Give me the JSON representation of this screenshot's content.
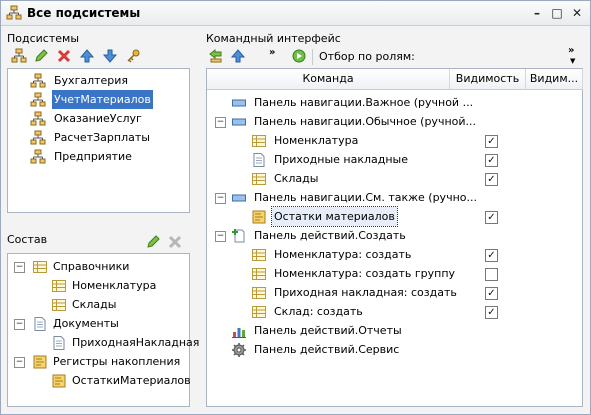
{
  "window": {
    "title": "Все подсистемы",
    "minimize_icon": "minimize-icon",
    "maximize_icon": "maximize-icon",
    "close_icon": "close-icon"
  },
  "subsystems": {
    "label": "Подсистемы",
    "toolbar": [
      "subsystem-tree-icon",
      "edit-pencil-icon",
      "delete-x-icon",
      "move-up-icon",
      "move-down-icon",
      "key-icon"
    ],
    "items": [
      {
        "label": "Бухгалтерия",
        "selected": false
      },
      {
        "label": "УчетМатериалов",
        "selected": true
      },
      {
        "label": "ОказаниеУслуг",
        "selected": false
      },
      {
        "label": "РасчетЗарплаты",
        "selected": false
      },
      {
        "label": "Предприятие",
        "selected": false
      }
    ]
  },
  "composition": {
    "label": "Состав",
    "toolbar": [
      "edit-pencil-icon",
      "delete-x-icon"
    ],
    "groups": [
      {
        "label": "Справочники",
        "icon": "catalog-icon",
        "children": [
          "Номенклатура",
          "Склады"
        ]
      },
      {
        "label": "Документы",
        "icon": "document-icon",
        "children": [
          "ПриходнаяНакладная"
        ]
      },
      {
        "label": "Регистры накопления",
        "icon": "register-icon",
        "children": [
          "ОстаткиМатериалов"
        ]
      }
    ]
  },
  "command_interface": {
    "label": "Командный интерфейс",
    "filter_label": "Отбор по ролям:",
    "columns": {
      "command": "Команда",
      "visibility": "Видимость",
      "visibility2": "Видим..."
    },
    "rows": [
      {
        "label": "Панель навигации.Важное (ручной ...",
        "level": 0,
        "expander": "",
        "icon": "nav-panel-icon",
        "checkbox": null
      },
      {
        "label": "Панель навигации.Обычное (ручной...",
        "level": 0,
        "expander": "−",
        "icon": "nav-panel-icon",
        "checkbox": null
      },
      {
        "label": "Номенклатура",
        "level": 1,
        "expander": "",
        "icon": "catalog-icon",
        "checkbox": true
      },
      {
        "label": "Приходные накладные",
        "level": 1,
        "expander": "",
        "icon": "document-icon",
        "checkbox": true
      },
      {
        "label": "Склады",
        "level": 1,
        "expander": "",
        "icon": "catalog-icon",
        "checkbox": true
      },
      {
        "label": "Панель навигации.См. также (ручно...",
        "level": 0,
        "expander": "−",
        "icon": "nav-panel-icon",
        "checkbox": null
      },
      {
        "label": "Остатки материалов",
        "level": 1,
        "expander": "",
        "icon": "register-icon",
        "checkbox": true,
        "focused": true
      },
      {
        "label": "Панель действий.Создать",
        "level": 0,
        "expander": "−",
        "icon": "create-action-icon",
        "checkbox": null
      },
      {
        "label": "Номенклатура: создать",
        "level": 1,
        "expander": "",
        "icon": "catalog-icon",
        "checkbox": true
      },
      {
        "label": "Номенклатура: создать группу",
        "level": 1,
        "expander": "",
        "icon": "catalog-icon",
        "checkbox": false
      },
      {
        "label": "Приходная накладная: создать",
        "level": 1,
        "expander": "",
        "icon": "catalog-icon",
        "checkbox": true
      },
      {
        "label": "Склад: создать",
        "level": 1,
        "expander": "",
        "icon": "catalog-icon",
        "checkbox": true
      },
      {
        "label": "Панель действий.Отчеты",
        "level": 0,
        "expander": "",
        "icon": "reports-icon",
        "checkbox": null
      },
      {
        "label": "Панель действий.Сервис",
        "level": 0,
        "expander": "",
        "icon": "service-gear-icon",
        "checkbox": null
      }
    ]
  }
}
